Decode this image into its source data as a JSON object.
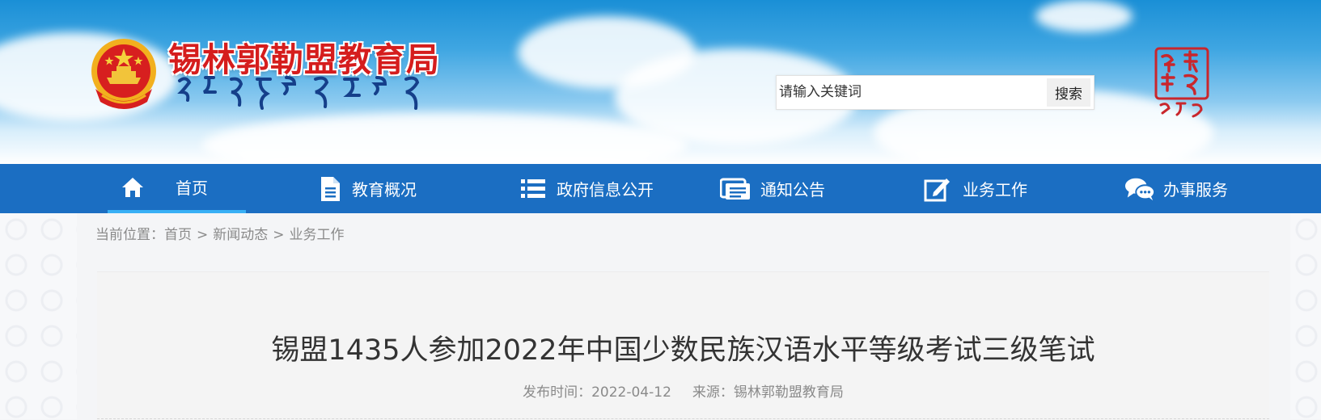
{
  "header": {
    "site_title": "锡林郭勒盟教育局",
    "search": {
      "placeholder": "请输入关键词",
      "button_label": "搜索"
    }
  },
  "nav": {
    "items": [
      {
        "label": "首页",
        "icon": "home-icon",
        "active": true
      },
      {
        "label": "教育概况",
        "icon": "document-icon"
      },
      {
        "label": "政府信息公开",
        "icon": "list-icon"
      },
      {
        "label": "通知公告",
        "icon": "notice-icon"
      },
      {
        "label": "业务工作",
        "icon": "edit-icon"
      },
      {
        "label": "办事服务",
        "icon": "chat-bubbles-icon"
      }
    ]
  },
  "breadcrumb": {
    "prefix": "当前位置：",
    "items": [
      "首页",
      "新闻动态",
      "业务工作"
    ],
    "separator": ">"
  },
  "article": {
    "title": "锡盟1435人参加2022年中国少数民族汉语水平等级考试三级笔试",
    "publish_label": "发布时间：",
    "publish_date": "2022-04-12",
    "source_label": "来源：",
    "source": "锡林郭勒盟教育局"
  },
  "colors": {
    "nav_bg": "#1b6ec2",
    "nav_active_underline": "#39b0f5",
    "title_red": "#d51d1d",
    "panel_bg": "#f4f4f4"
  }
}
